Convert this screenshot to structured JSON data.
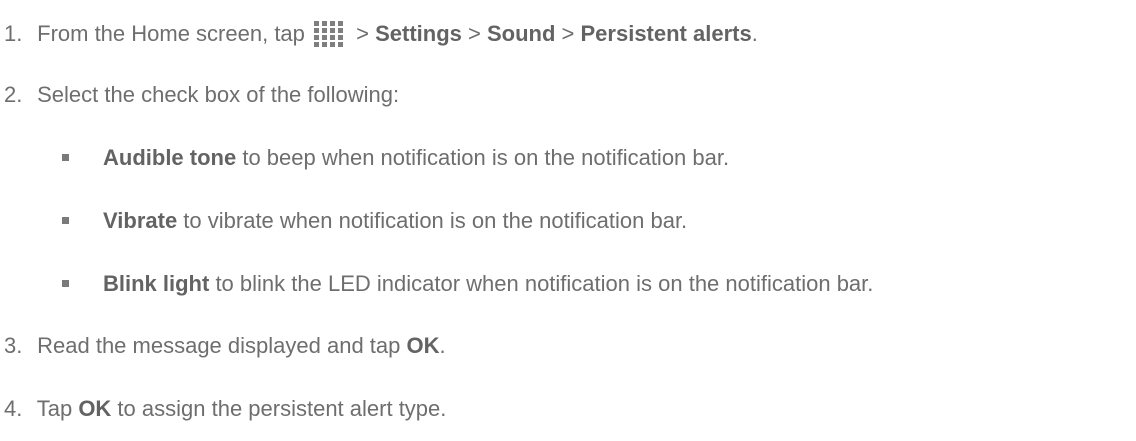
{
  "steps": [
    {
      "num": "1.",
      "text_a": "From the Home screen, tap",
      "icon": "apps-grid-icon",
      "sep1": " > ",
      "settings": "Settings",
      "sep2": " > ",
      "sound": "Sound",
      "sep3": " > ",
      "persistent": "Persistent alerts",
      "end": "."
    },
    {
      "num": "2.",
      "text": "Select the check box of the following:"
    },
    {
      "num": "3.",
      "text_a": "Read the message displayed and tap ",
      "ok": "OK",
      "end": "."
    },
    {
      "num": "4.",
      "text_a": "Tap ",
      "ok": "OK",
      "text_b": " to assign the persistent alert type."
    }
  ],
  "options": [
    {
      "label": "Audible tone",
      "desc": " to beep when notification is on the notification bar."
    },
    {
      "label": "Vibrate",
      "desc": " to vibrate when notification is on the notification bar."
    },
    {
      "label": "Blink light",
      "desc": " to blink the LED indicator when notification is on the notification bar."
    }
  ],
  "colors": {
    "text": "#6e6e6e",
    "icon": "#7f7f7f"
  }
}
